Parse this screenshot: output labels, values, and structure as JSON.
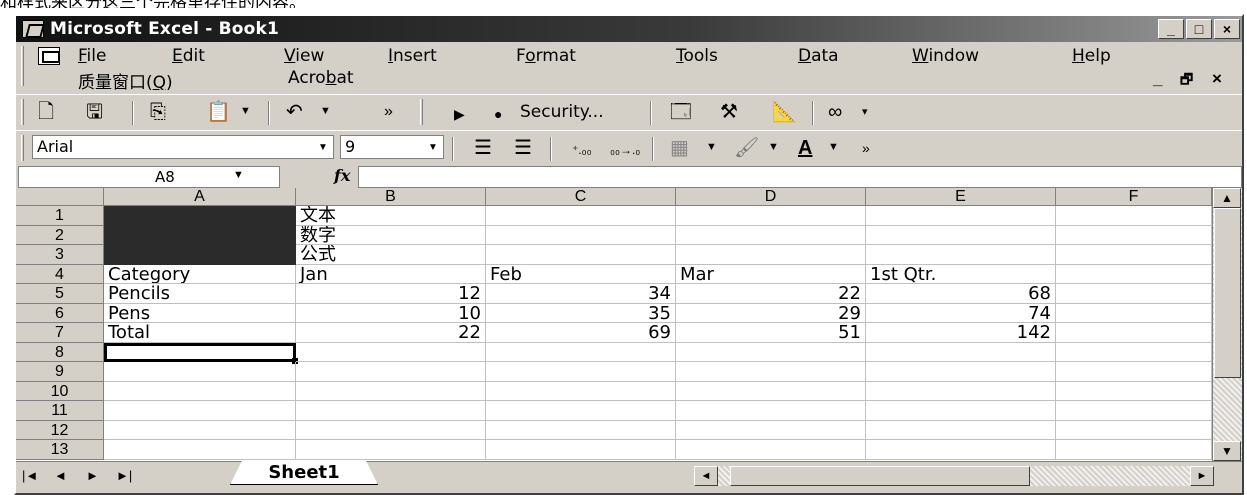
{
  "caption": "和样式来区分这三个完格里存住的内容。",
  "titlebar": {
    "title": "Microsoft Excel - Book1",
    "minimize": "_",
    "maximize": "□",
    "close": "×"
  },
  "menubar": {
    "row1": [
      {
        "prefix": "",
        "ul": "F",
        "rest": "ile"
      },
      {
        "prefix": "",
        "ul": "E",
        "rest": "dit"
      },
      {
        "prefix": "",
        "ul": "V",
        "rest": "iew"
      },
      {
        "prefix": "",
        "ul": "I",
        "rest": "nsert"
      },
      {
        "prefix": "F",
        "ul": "o",
        "rest": "rmat"
      },
      {
        "prefix": "",
        "ul": "T",
        "rest": "ools"
      },
      {
        "prefix": "",
        "ul": "D",
        "rest": "ata"
      },
      {
        "prefix": "",
        "ul": "W",
        "rest": "indow"
      },
      {
        "prefix": "",
        "ul": "H",
        "rest": "elp"
      }
    ],
    "row2": [
      {
        "prefix": "质量窗口(",
        "ul": "Q",
        "rest": ")"
      },
      {
        "prefix": "Acro",
        "ul": "b",
        "rest": "at"
      }
    ],
    "mdi_minimize": "_",
    "mdi_restore": "🗗",
    "mdi_close": "×"
  },
  "standard_toolbar": {
    "security_label": "Security...",
    "overflow": "»"
  },
  "formatting_toolbar": {
    "font_name": "Arial",
    "font_size": "9",
    "overflow": "»"
  },
  "formula_bar": {
    "name_box": "A8",
    "fx": "fx",
    "formula": ""
  },
  "sheet": {
    "columns": [
      "A",
      "B",
      "C",
      "D",
      "E",
      "F"
    ],
    "rows": [
      "1",
      "2",
      "3",
      "4",
      "5",
      "6",
      "7",
      "8",
      "9",
      "10",
      "11",
      "12",
      "13"
    ],
    "cells": {
      "B1": "文本",
      "B2": "数字",
      "B3": "公式",
      "A4": "Category",
      "B4": "Jan",
      "C4": "Feb",
      "D4": "Mar",
      "E4": "1st Qtr.",
      "A5": "Pencils",
      "B5": "12",
      "C5": "34",
      "D5": "22",
      "E5": "68",
      "A6": "Pens",
      "B6": "10",
      "C6": "35",
      "D6": "29",
      "E6": "74",
      "A7": "Total",
      "B7": "22",
      "C7": "69",
      "D7": "51",
      "E7": "142"
    },
    "dark_cells": [
      "A1",
      "A2",
      "A3"
    ],
    "selected_cell": "A8"
  },
  "tabs": {
    "sheet_tab": "Sheet1",
    "nav_first": "|◄",
    "nav_prev": "◄",
    "nav_next": "►",
    "nav_last": "►|"
  }
}
